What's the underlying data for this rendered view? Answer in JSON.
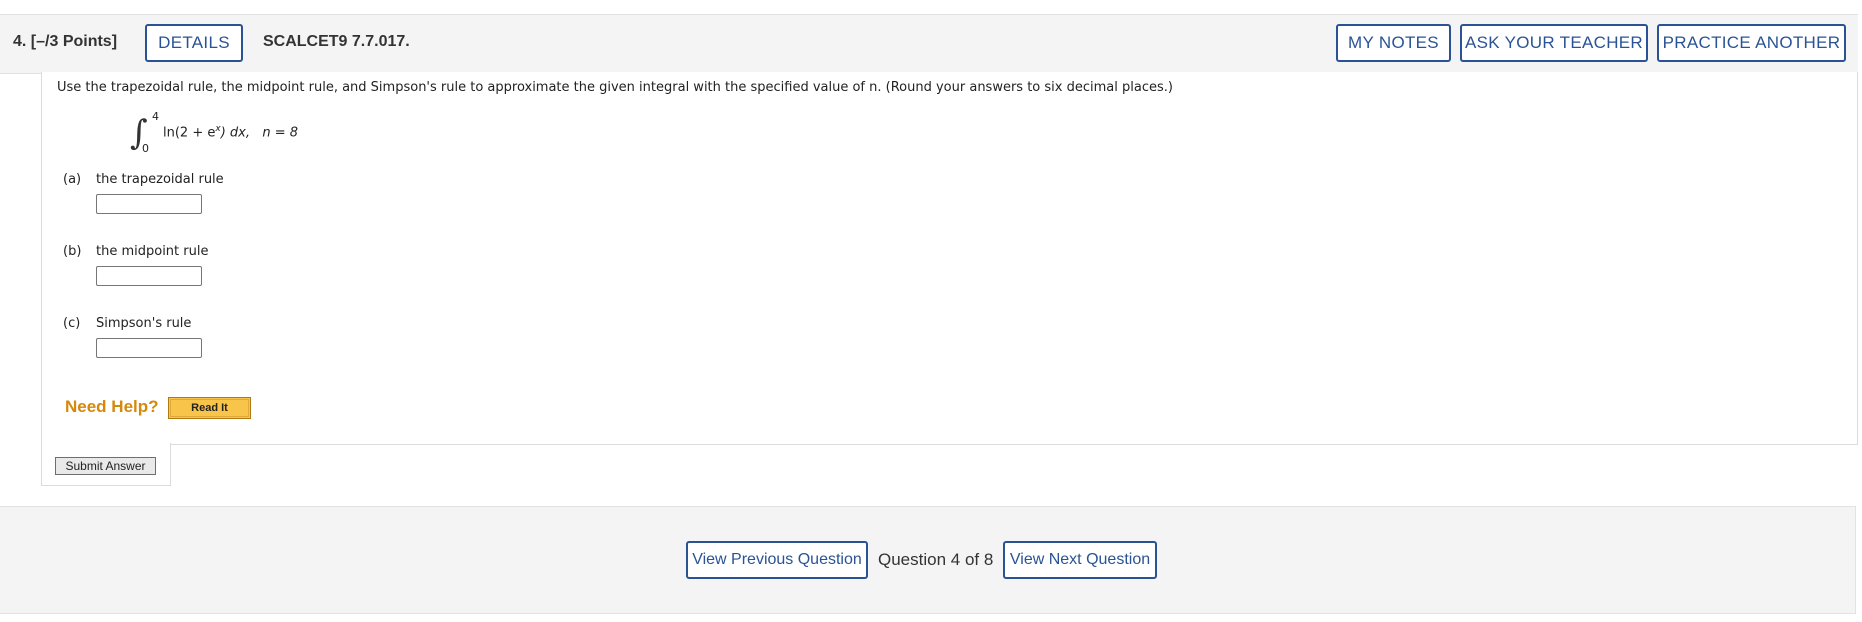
{
  "header": {
    "question_number": "4.",
    "points": "[–/3 Points]",
    "details_label": "DETAILS",
    "question_code": "SCALCET9 7.7.017.",
    "my_notes_label": "MY NOTES",
    "ask_teacher_label": "ASK YOUR TEACHER",
    "practice_another_label": "PRACTICE ANOTHER"
  },
  "question": {
    "prompt": "Use the trapezoidal rule, the midpoint rule, and Simpson's rule to approximate the given integral with the specified value of n. (Round your answers to six decimal places.)",
    "integral": {
      "lower": "0",
      "upper": "4",
      "integrand_prefix": "ln(2 + e",
      "exponent": "x",
      "integrand_suffix": ") dx,",
      "n_spec": "n = 8"
    },
    "parts": [
      {
        "letter": "(a)",
        "label": "the trapezoidal rule",
        "value": ""
      },
      {
        "letter": "(b)",
        "label": "the midpoint rule",
        "value": ""
      },
      {
        "letter": "(c)",
        "label": "Simpson's rule",
        "value": ""
      }
    ]
  },
  "help": {
    "need_help_label": "Need Help?",
    "read_it_label": "Read It"
  },
  "submit_label": "Submit Answer",
  "footer": {
    "prev_label": "View Previous Question",
    "counter": "Question 4 of 8",
    "next_label": "View Next Question"
  },
  "colors": {
    "accent": "#2a5395",
    "help": "#d4890a",
    "read_it_bg": "#f8c44a"
  }
}
